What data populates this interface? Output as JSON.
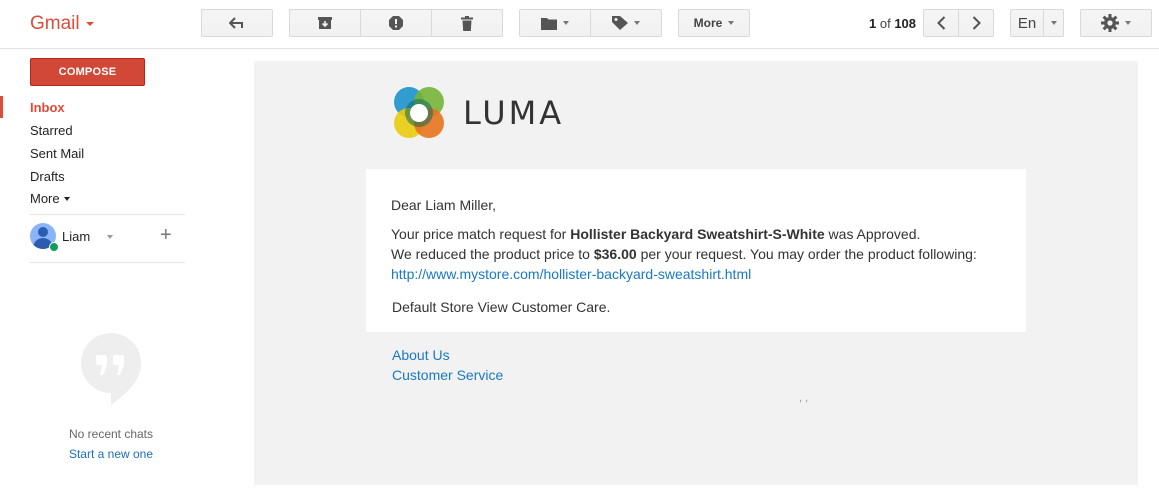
{
  "header": {
    "app_label": "Gmail",
    "pager": {
      "current": "1",
      "separator": "of",
      "total": "108"
    },
    "more_label": "More",
    "language_label": "En"
  },
  "sidebar": {
    "compose_label": "COMPOSE",
    "items": [
      {
        "label": "Inbox"
      },
      {
        "label": "Starred"
      },
      {
        "label": "Sent Mail"
      },
      {
        "label": "Drafts"
      },
      {
        "label": "More"
      }
    ],
    "user": {
      "name": "Liam"
    },
    "chat": {
      "empty_text": "No recent chats",
      "start_link": "Start a new one"
    }
  },
  "email": {
    "brand": "LUMA",
    "greeting": "Dear Liam Miller,",
    "line1_prefix": "Your price match request for ",
    "line1_product": "Hollister Backyard Sweatshirt-S-White",
    "line1_suffix": " was Approved.",
    "line2_prefix": "We reduced the product price to ",
    "line2_price": "$36.00",
    "line2_suffix": " per your request. You may order the product following:",
    "product_url": "http://www.mystore.com/hollister-backyard-sweatshirt.html",
    "signature": "Default Store View Customer Care.",
    "footer_links": [
      "About Us",
      "Customer Service"
    ],
    "trailing_marks": ", ,"
  },
  "colors": {
    "gmail_red": "#dd4b39",
    "compose_red": "#d14836",
    "link_blue": "#1979c3",
    "pane_gray": "#f2f2f2"
  }
}
